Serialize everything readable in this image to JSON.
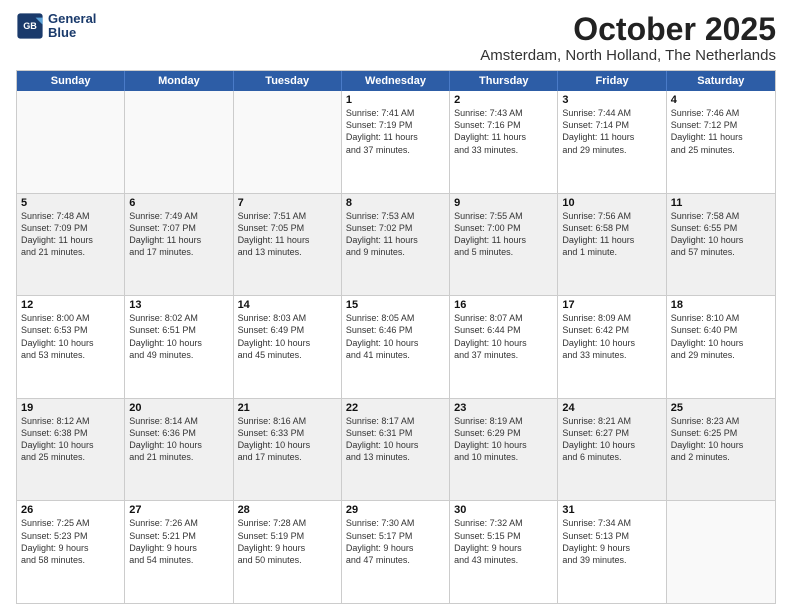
{
  "logo": {
    "line1": "General",
    "line2": "Blue"
  },
  "title": "October 2025",
  "subtitle": "Amsterdam, North Holland, The Netherlands",
  "headers": [
    "Sunday",
    "Monday",
    "Tuesday",
    "Wednesday",
    "Thursday",
    "Friday",
    "Saturday"
  ],
  "weeks": [
    [
      {
        "day": "",
        "text": ""
      },
      {
        "day": "",
        "text": ""
      },
      {
        "day": "",
        "text": ""
      },
      {
        "day": "1",
        "text": "Sunrise: 7:41 AM\nSunset: 7:19 PM\nDaylight: 11 hours\nand 37 minutes."
      },
      {
        "day": "2",
        "text": "Sunrise: 7:43 AM\nSunset: 7:16 PM\nDaylight: 11 hours\nand 33 minutes."
      },
      {
        "day": "3",
        "text": "Sunrise: 7:44 AM\nSunset: 7:14 PM\nDaylight: 11 hours\nand 29 minutes."
      },
      {
        "day": "4",
        "text": "Sunrise: 7:46 AM\nSunset: 7:12 PM\nDaylight: 11 hours\nand 25 minutes."
      }
    ],
    [
      {
        "day": "5",
        "text": "Sunrise: 7:48 AM\nSunset: 7:09 PM\nDaylight: 11 hours\nand 21 minutes."
      },
      {
        "day": "6",
        "text": "Sunrise: 7:49 AM\nSunset: 7:07 PM\nDaylight: 11 hours\nand 17 minutes."
      },
      {
        "day": "7",
        "text": "Sunrise: 7:51 AM\nSunset: 7:05 PM\nDaylight: 11 hours\nand 13 minutes."
      },
      {
        "day": "8",
        "text": "Sunrise: 7:53 AM\nSunset: 7:02 PM\nDaylight: 11 hours\nand 9 minutes."
      },
      {
        "day": "9",
        "text": "Sunrise: 7:55 AM\nSunset: 7:00 PM\nDaylight: 11 hours\nand 5 minutes."
      },
      {
        "day": "10",
        "text": "Sunrise: 7:56 AM\nSunset: 6:58 PM\nDaylight: 11 hours\nand 1 minute."
      },
      {
        "day": "11",
        "text": "Sunrise: 7:58 AM\nSunset: 6:55 PM\nDaylight: 10 hours\nand 57 minutes."
      }
    ],
    [
      {
        "day": "12",
        "text": "Sunrise: 8:00 AM\nSunset: 6:53 PM\nDaylight: 10 hours\nand 53 minutes."
      },
      {
        "day": "13",
        "text": "Sunrise: 8:02 AM\nSunset: 6:51 PM\nDaylight: 10 hours\nand 49 minutes."
      },
      {
        "day": "14",
        "text": "Sunrise: 8:03 AM\nSunset: 6:49 PM\nDaylight: 10 hours\nand 45 minutes."
      },
      {
        "day": "15",
        "text": "Sunrise: 8:05 AM\nSunset: 6:46 PM\nDaylight: 10 hours\nand 41 minutes."
      },
      {
        "day": "16",
        "text": "Sunrise: 8:07 AM\nSunset: 6:44 PM\nDaylight: 10 hours\nand 37 minutes."
      },
      {
        "day": "17",
        "text": "Sunrise: 8:09 AM\nSunset: 6:42 PM\nDaylight: 10 hours\nand 33 minutes."
      },
      {
        "day": "18",
        "text": "Sunrise: 8:10 AM\nSunset: 6:40 PM\nDaylight: 10 hours\nand 29 minutes."
      }
    ],
    [
      {
        "day": "19",
        "text": "Sunrise: 8:12 AM\nSunset: 6:38 PM\nDaylight: 10 hours\nand 25 minutes."
      },
      {
        "day": "20",
        "text": "Sunrise: 8:14 AM\nSunset: 6:36 PM\nDaylight: 10 hours\nand 21 minutes."
      },
      {
        "day": "21",
        "text": "Sunrise: 8:16 AM\nSunset: 6:33 PM\nDaylight: 10 hours\nand 17 minutes."
      },
      {
        "day": "22",
        "text": "Sunrise: 8:17 AM\nSunset: 6:31 PM\nDaylight: 10 hours\nand 13 minutes."
      },
      {
        "day": "23",
        "text": "Sunrise: 8:19 AM\nSunset: 6:29 PM\nDaylight: 10 hours\nand 10 minutes."
      },
      {
        "day": "24",
        "text": "Sunrise: 8:21 AM\nSunset: 6:27 PM\nDaylight: 10 hours\nand 6 minutes."
      },
      {
        "day": "25",
        "text": "Sunrise: 8:23 AM\nSunset: 6:25 PM\nDaylight: 10 hours\nand 2 minutes."
      }
    ],
    [
      {
        "day": "26",
        "text": "Sunrise: 7:25 AM\nSunset: 5:23 PM\nDaylight: 9 hours\nand 58 minutes."
      },
      {
        "day": "27",
        "text": "Sunrise: 7:26 AM\nSunset: 5:21 PM\nDaylight: 9 hours\nand 54 minutes."
      },
      {
        "day": "28",
        "text": "Sunrise: 7:28 AM\nSunset: 5:19 PM\nDaylight: 9 hours\nand 50 minutes."
      },
      {
        "day": "29",
        "text": "Sunrise: 7:30 AM\nSunset: 5:17 PM\nDaylight: 9 hours\nand 47 minutes."
      },
      {
        "day": "30",
        "text": "Sunrise: 7:32 AM\nSunset: 5:15 PM\nDaylight: 9 hours\nand 43 minutes."
      },
      {
        "day": "31",
        "text": "Sunrise: 7:34 AM\nSunset: 5:13 PM\nDaylight: 9 hours\nand 39 minutes."
      },
      {
        "day": "",
        "text": ""
      }
    ]
  ]
}
